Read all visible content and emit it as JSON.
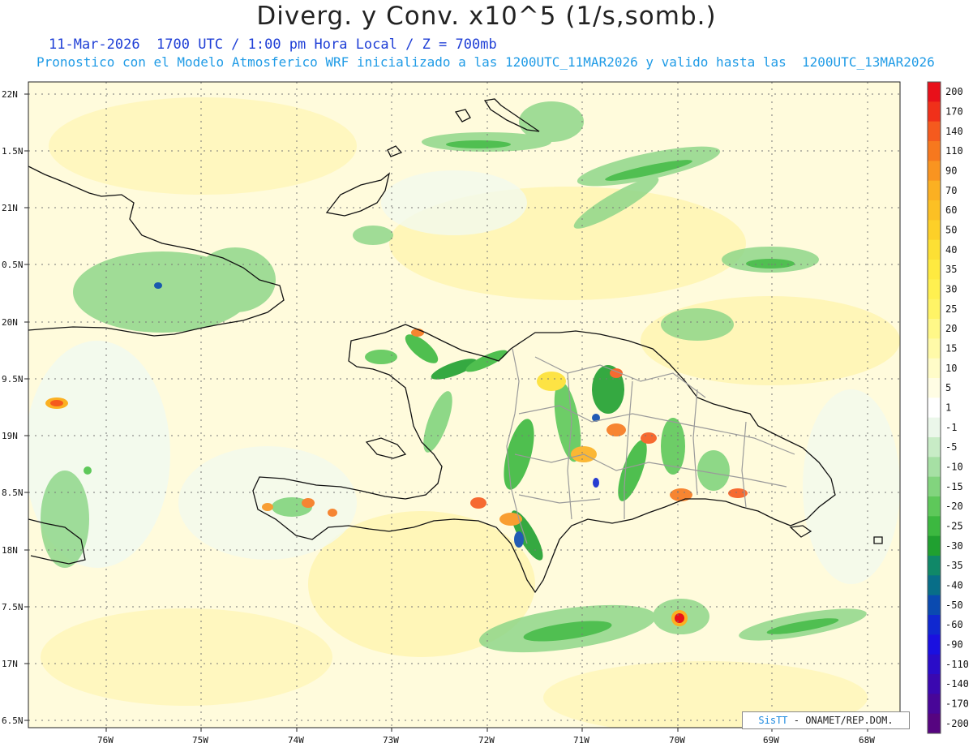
{
  "header": {
    "title": "Diverg. y Conv. x10^5 (1/s,somb.)",
    "subtitle_time": "11-Mar-2026  1700 UTC / 1:00 pm Hora Local / Z = 700mb",
    "subtitle_model": "Pronostico con el Modelo Atmosferico WRF inicializado a las 1200UTC_11MAR2026 y valido hasta las  1200UTC_13MAR2026"
  },
  "axes": {
    "lat_labels": [
      "22N",
      "1.5N",
      "21N",
      "0.5N",
      "20N",
      "9.5N",
      "19N",
      "8.5N",
      "18N",
      "7.5N",
      "17N",
      "6.5N"
    ],
    "lon_labels": [
      "76W",
      "75W",
      "74W",
      "73W",
      "72W",
      "71W",
      "70W",
      "69W",
      "68W"
    ]
  },
  "colorbar": {
    "labels": [
      "200",
      "170",
      "140",
      "110",
      "90",
      "70",
      "60",
      "50",
      "40",
      "35",
      "30",
      "25",
      "20",
      "15",
      "10",
      "5",
      "1",
      "-1",
      "-5",
      "-10",
      "-15",
      "-20",
      "-25",
      "-30",
      "-35",
      "-40",
      "-50",
      "-60",
      "-90",
      "-110",
      "-140",
      "-170",
      "-200"
    ],
    "colors": [
      "#e8101a",
      "#f0301a",
      "#f55a1e",
      "#f7781e",
      "#f99420",
      "#fbb022",
      "#fcc024",
      "#fdd028",
      "#fde034",
      "#feea40",
      "#fff050",
      "#fff466",
      "#fff888",
      "#fffaa8",
      "#fffcc8",
      "#fffde4",
      "#ffffff",
      "#ebf7ea",
      "#c8ecc6",
      "#a6e0a4",
      "#82d47e",
      "#5ec85a",
      "#3cb840",
      "#20a030",
      "#108868",
      "#086e88",
      "#0a4ab0",
      "#1028d0",
      "#1a10e0",
      "#2a0cc8",
      "#3a08b0",
      "#480698",
      "#560480"
    ]
  },
  "credit": {
    "brand": "SisTT",
    "text": " - ONAMET/REP.DOM."
  }
}
